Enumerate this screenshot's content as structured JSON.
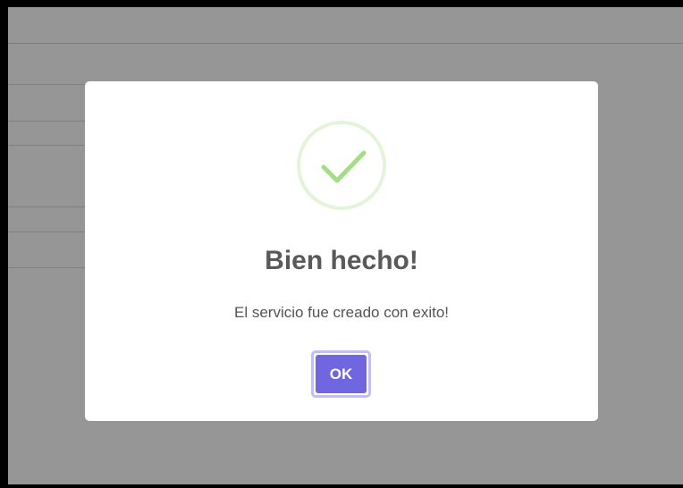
{
  "dialog": {
    "title": "Bien hecho!",
    "message": "El servicio fue creado con exito!",
    "confirm_label": "OK",
    "icon": "success-check-icon"
  },
  "colors": {
    "overlay": "#969696",
    "modal_background": "#ffffff",
    "success_green": "#a5dc86",
    "confirm_button": "#7066e0",
    "title_text": "#595959"
  }
}
